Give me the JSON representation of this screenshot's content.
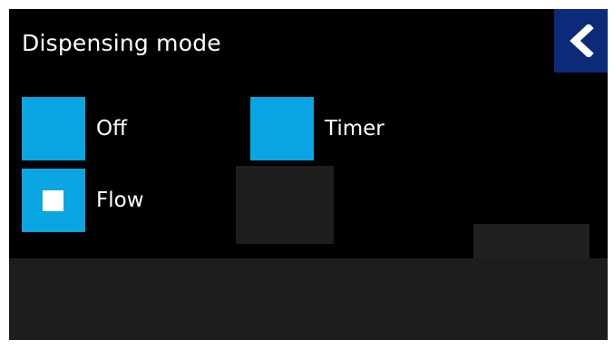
{
  "app": {
    "title": "Dispensing mode"
  },
  "back_button": {
    "icon": "chevron-left-icon",
    "color": "#0c2a7a"
  },
  "options": {
    "off": {
      "label": "Off",
      "selected": false
    },
    "timer": {
      "label": "Timer",
      "selected": false
    },
    "flow": {
      "label": "Flow",
      "selected": true
    }
  },
  "colors": {
    "background": "#000000",
    "option_box": "#0aa6e3",
    "selected_mark": "#ffffff",
    "text": "#ffffff"
  }
}
